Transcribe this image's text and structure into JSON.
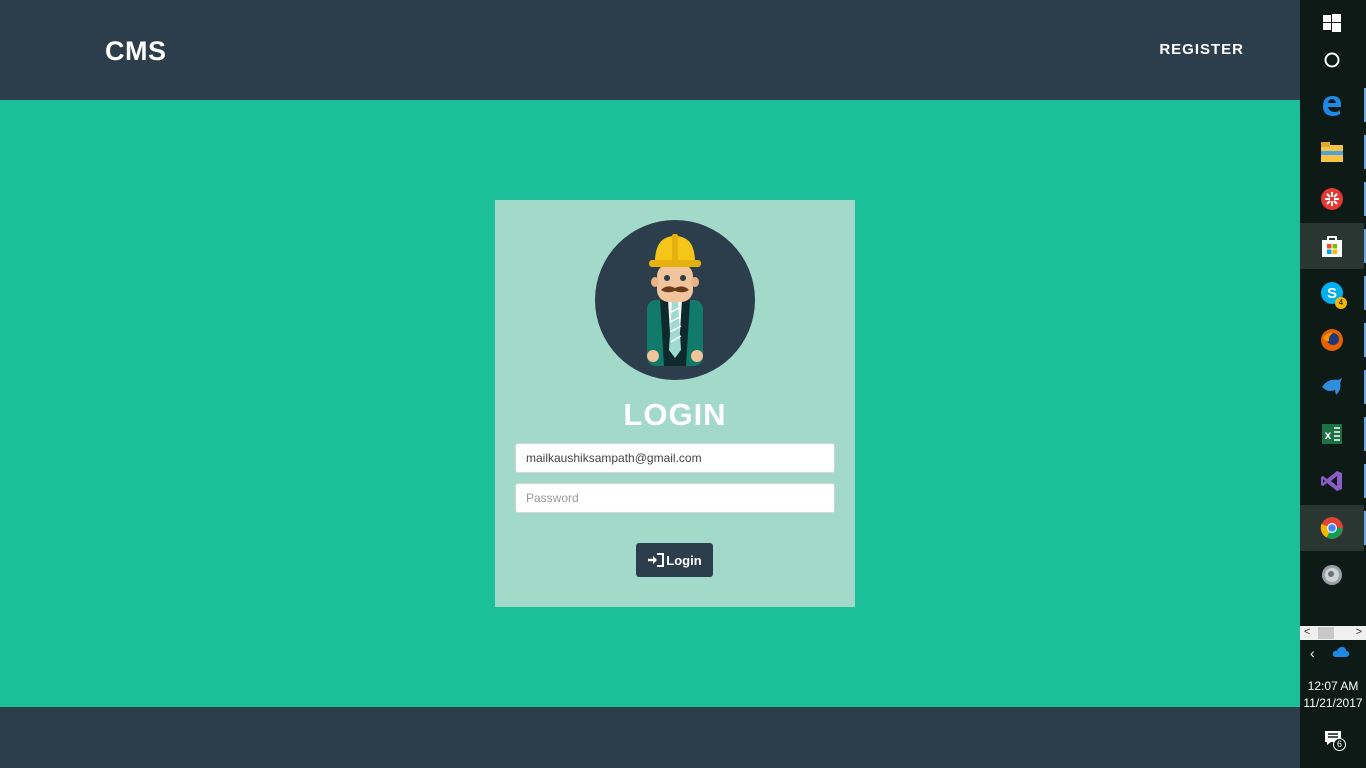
{
  "navbar": {
    "brand": "CMS",
    "register_label": "REGISTER"
  },
  "login": {
    "title": "LOGIN",
    "email_value": "mailkaushiksampath@gmail.com",
    "password_placeholder": "Password",
    "button_label": "Login"
  },
  "taskbar": {
    "skype_badge": "4",
    "clock_time": "12:07 AM",
    "clock_date": "11/21/2017",
    "notification_count": "6"
  },
  "colors": {
    "navbar": "#2c3e4c",
    "background": "#1bc098",
    "card": "#a2d9c9",
    "button": "#2c3e4c",
    "taskbar": "#0d1a16"
  },
  "icons": {
    "avatar": "worker-avatar",
    "login_button": "sign-in-icon",
    "taskbar": [
      "windows-start-icon",
      "cortana-icon",
      "edge-icon",
      "file-explorer-icon",
      "app-red-icon",
      "store-icon",
      "skype-icon",
      "firefox-icon",
      "dolphin-icon",
      "excel-icon",
      "visual-studio-icon",
      "chrome-icon",
      "disc-icon"
    ]
  }
}
